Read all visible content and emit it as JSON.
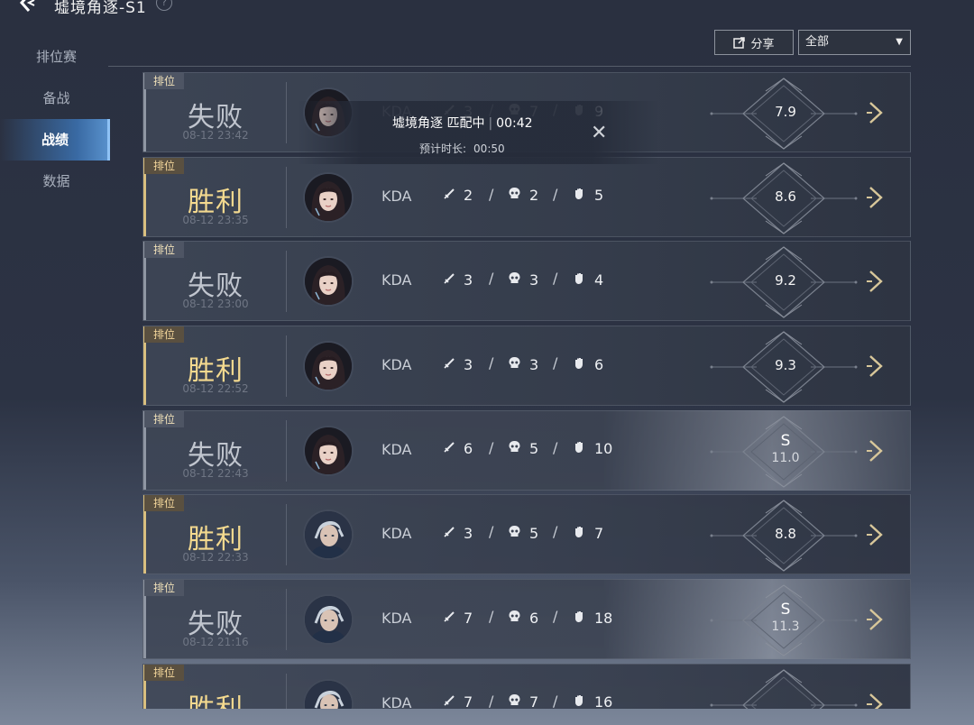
{
  "header": {
    "title": "墟境角逐-S1",
    "help": "?"
  },
  "sidebar": {
    "items": [
      {
        "label": "排位赛",
        "active": false
      },
      {
        "label": "备战",
        "active": false
      },
      {
        "label": "战绩",
        "active": true
      },
      {
        "label": "数据",
        "active": false
      }
    ]
  },
  "toolbar": {
    "share_label": "分享",
    "filter_value": "全部"
  },
  "overlay": {
    "title": "墟境角逐 匹配中",
    "elapsed": "00:42",
    "expected_label": "预计时长:",
    "expected_value": "00:50"
  },
  "colors": {
    "win": "#f3d98f",
    "loss": "#c0c5ce",
    "accent": "#6aa3dd"
  },
  "kda_label": "KDA",
  "rank_tag": "排位",
  "matches": [
    {
      "result": "失败",
      "win": false,
      "time": "08-12 23:42",
      "hero": "female",
      "k": "3",
      "d": "7",
      "a": "9",
      "score": "7.9",
      "grade": ""
    },
    {
      "result": "胜利",
      "win": true,
      "time": "08-12 23:35",
      "hero": "female",
      "k": "2",
      "d": "2",
      "a": "5",
      "score": "8.6",
      "grade": ""
    },
    {
      "result": "失败",
      "win": false,
      "time": "08-12 23:00",
      "hero": "female",
      "k": "3",
      "d": "3",
      "a": "4",
      "score": "9.2",
      "grade": ""
    },
    {
      "result": "胜利",
      "win": true,
      "time": "08-12 22:52",
      "hero": "female",
      "k": "3",
      "d": "3",
      "a": "6",
      "score": "9.3",
      "grade": ""
    },
    {
      "result": "失败",
      "win": false,
      "time": "08-12 22:43",
      "hero": "female",
      "k": "6",
      "d": "5",
      "a": "10",
      "score": "11.0",
      "grade": "S"
    },
    {
      "result": "胜利",
      "win": true,
      "time": "08-12 22:33",
      "hero": "male",
      "k": "3",
      "d": "5",
      "a": "7",
      "score": "8.8",
      "grade": ""
    },
    {
      "result": "失败",
      "win": false,
      "time": "08-12 21:16",
      "hero": "male",
      "k": "7",
      "d": "6",
      "a": "18",
      "score": "11.3",
      "grade": "S"
    },
    {
      "result": "胜利",
      "win": true,
      "time": "",
      "hero": "male",
      "k": "7",
      "d": "7",
      "a": "16",
      "score": "",
      "grade": ""
    }
  ]
}
